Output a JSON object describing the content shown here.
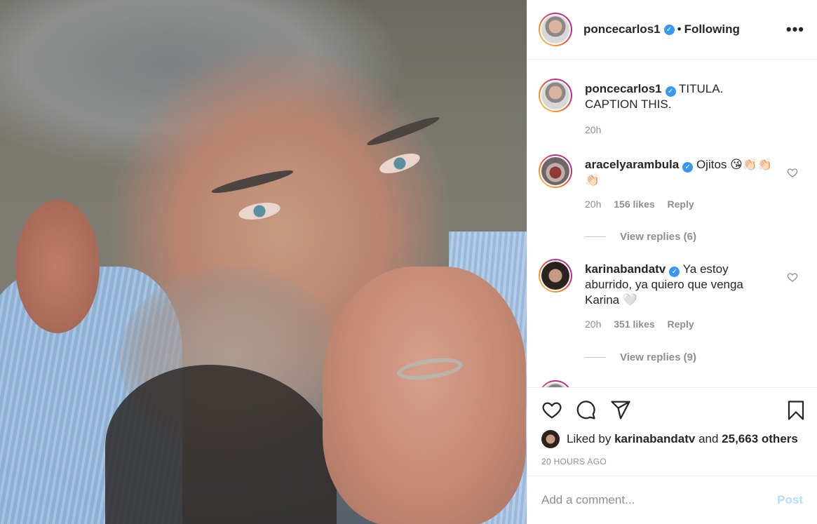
{
  "post": {
    "image_alt": "man resting chin on hand",
    "colors": {
      "verified": "#3897f0",
      "post_button": "#b2dffc",
      "muted": "#8e8e8e"
    }
  },
  "header": {
    "username": "poncecarlos1",
    "separator": "•",
    "follow_status": "Following",
    "more_icon": "more-horizontal-icon"
  },
  "caption": {
    "username": "poncecarlos1",
    "text": "TITULA. CAPTION THIS.",
    "time": "20h"
  },
  "comments": [
    {
      "username": "aracelyarambula",
      "text": "Ojitos 😘👏🏻👏🏻👏🏻",
      "time": "20h",
      "likes": "156 likes",
      "reply_label": "Reply",
      "view_replies": "View replies (6)"
    },
    {
      "username": "karinabandatv",
      "text": "Ya estoy aburrido, ya quiero que venga Karina 🤍",
      "time": "20h",
      "likes": "351 likes",
      "reply_label": "Reply",
      "view_replies": "View replies (9)"
    }
  ],
  "actions": {
    "like_icon": "heart-icon",
    "comment_icon": "comment-icon",
    "share_icon": "paper-plane-icon",
    "save_icon": "bookmark-icon"
  },
  "likes": {
    "prefix": "Liked by",
    "user": "karinabandatv",
    "joiner": "and",
    "others": "25,663 others"
  },
  "timestamp": "20 HOURS AGO",
  "add_comment": {
    "placeholder": "Add a comment...",
    "post_label": "Post"
  }
}
